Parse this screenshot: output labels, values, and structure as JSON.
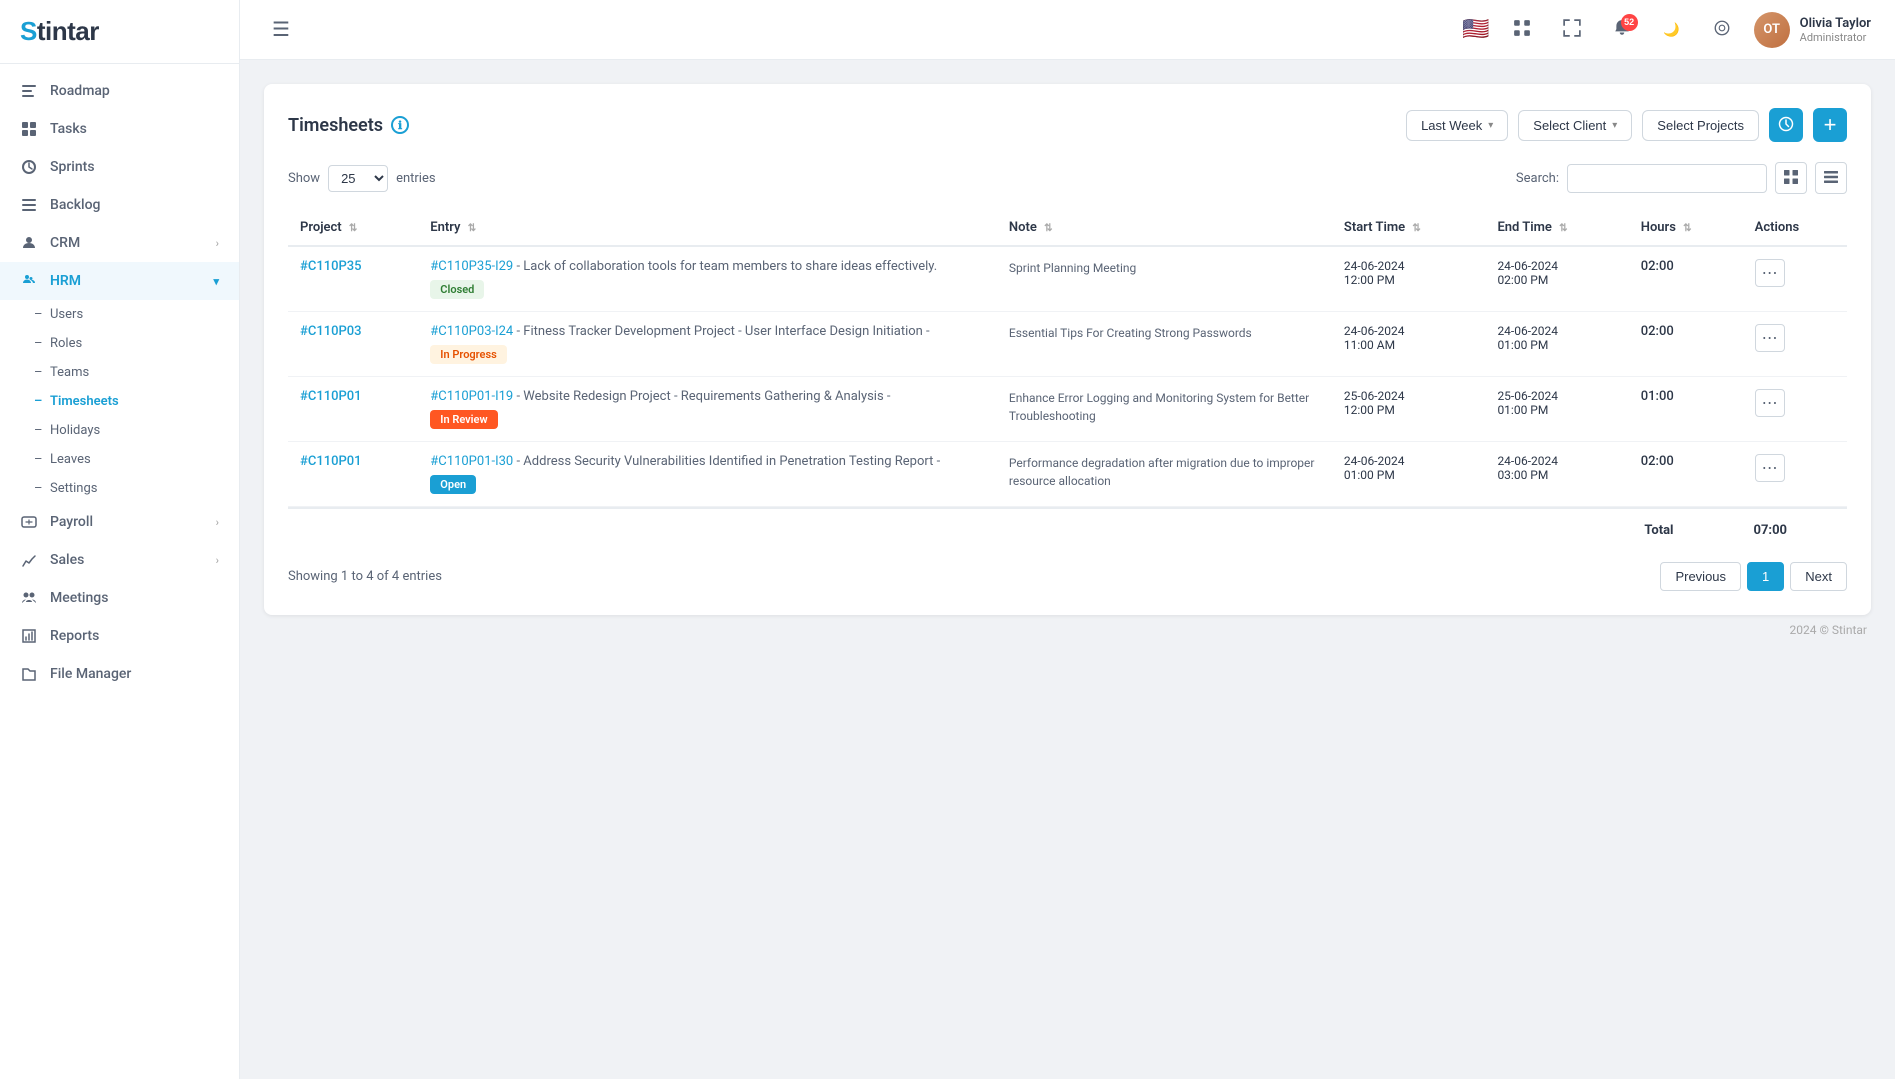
{
  "app": {
    "logo": "Stintar",
    "logo_s": "S"
  },
  "sidebar": {
    "items": [
      {
        "id": "roadmap",
        "label": "Roadmap",
        "icon": "roadmap-icon",
        "hasArrow": false
      },
      {
        "id": "tasks",
        "label": "Tasks",
        "icon": "tasks-icon",
        "hasArrow": false
      },
      {
        "id": "sprints",
        "label": "Sprints",
        "icon": "sprints-icon",
        "hasArrow": false
      },
      {
        "id": "backlog",
        "label": "Backlog",
        "icon": "backlog-icon",
        "hasArrow": false
      },
      {
        "id": "crm",
        "label": "CRM",
        "icon": "crm-icon",
        "hasArrow": true
      },
      {
        "id": "hrm",
        "label": "HRM",
        "icon": "hrm-icon",
        "hasArrow": true,
        "active": true,
        "expanded": true
      },
      {
        "id": "payroll",
        "label": "Payroll",
        "icon": "payroll-icon",
        "hasArrow": true
      },
      {
        "id": "sales",
        "label": "Sales",
        "icon": "sales-icon",
        "hasArrow": true
      },
      {
        "id": "meetings",
        "label": "Meetings",
        "icon": "meetings-icon",
        "hasArrow": false
      },
      {
        "id": "reports",
        "label": "Reports",
        "icon": "reports-icon",
        "hasArrow": false
      },
      {
        "id": "file-manager",
        "label": "File Manager",
        "icon": "file-manager-icon",
        "hasArrow": false
      }
    ],
    "hrm_sub_items": [
      {
        "id": "users",
        "label": "Users",
        "active": false
      },
      {
        "id": "roles",
        "label": "Roles",
        "active": false
      },
      {
        "id": "teams",
        "label": "Teams",
        "active": false
      },
      {
        "id": "timesheets",
        "label": "Timesheets",
        "active": true
      },
      {
        "id": "holidays",
        "label": "Holidays",
        "active": false
      },
      {
        "id": "leaves",
        "label": "Leaves",
        "active": false
      },
      {
        "id": "settings",
        "label": "Settings",
        "active": false
      }
    ]
  },
  "topbar": {
    "menu_icon": "☰",
    "notification_count": "52",
    "user": {
      "name": "Olivia Taylor",
      "role": "Administrator",
      "avatar_initials": "OT"
    }
  },
  "timesheets": {
    "title": "Timesheets",
    "filter_last_week": "Last Week",
    "filter_select_client": "Select Client",
    "filter_select_projects": "Select Projects",
    "show_label": "Show",
    "entries_label": "entries",
    "show_value": "25",
    "search_label": "Search:",
    "search_placeholder": "",
    "columns": {
      "project": "Project",
      "entry": "Entry",
      "note": "Note",
      "start_time": "Start Time",
      "end_time": "End Time",
      "hours": "Hours",
      "actions": "Actions"
    },
    "rows": [
      {
        "project_id": "#C110P35",
        "entry_id": "#C110P35-I29",
        "entry_text": "Lack of collaboration tools for team members to share ideas effectively.",
        "status": "Closed",
        "status_type": "closed",
        "note": "Sprint Planning Meeting",
        "start_date": "24-06-2024",
        "start_time": "12:00 PM",
        "end_date": "24-06-2024",
        "end_time": "02:00 PM",
        "hours": "02:00"
      },
      {
        "project_id": "#C110P03",
        "entry_id": "#C110P03-I24",
        "entry_text": "Fitness Tracker Development Project - User Interface Design Initiation -",
        "status": "In Progress",
        "status_type": "inprogress",
        "note": "Essential Tips For Creating Strong Passwords",
        "start_date": "24-06-2024",
        "start_time": "11:00 AM",
        "end_date": "24-06-2024",
        "end_time": "01:00 PM",
        "hours": "02:00"
      },
      {
        "project_id": "#C110P01",
        "entry_id": "#C110P01-I19",
        "entry_text": "Website Redesign Project - Requirements Gathering & Analysis -",
        "status": "In Review",
        "status_type": "inreview",
        "note": "Enhance Error Logging and Monitoring System for Better Troubleshooting",
        "start_date": "25-06-2024",
        "start_time": "12:00 PM",
        "end_date": "25-06-2024",
        "end_time": "01:00 PM",
        "hours": "01:00"
      },
      {
        "project_id": "#C110P01",
        "entry_id": "#C110P01-I30",
        "entry_text": "Address Security Vulnerabilities Identified in Penetration Testing Report -",
        "status": "Open",
        "status_type": "open",
        "note": "Performance degradation after migration due to improper resource allocation",
        "start_date": "24-06-2024",
        "start_time": "01:00 PM",
        "end_date": "24-06-2024",
        "end_time": "03:00 PM",
        "hours": "02:00"
      }
    ],
    "total_label": "Total",
    "total_hours": "07:00",
    "showing_text": "Showing 1 to 4 of 4 entries",
    "pagination": {
      "previous": "Previous",
      "next": "Next",
      "current_page": "1"
    },
    "copyright": "2024 © Stintar"
  }
}
